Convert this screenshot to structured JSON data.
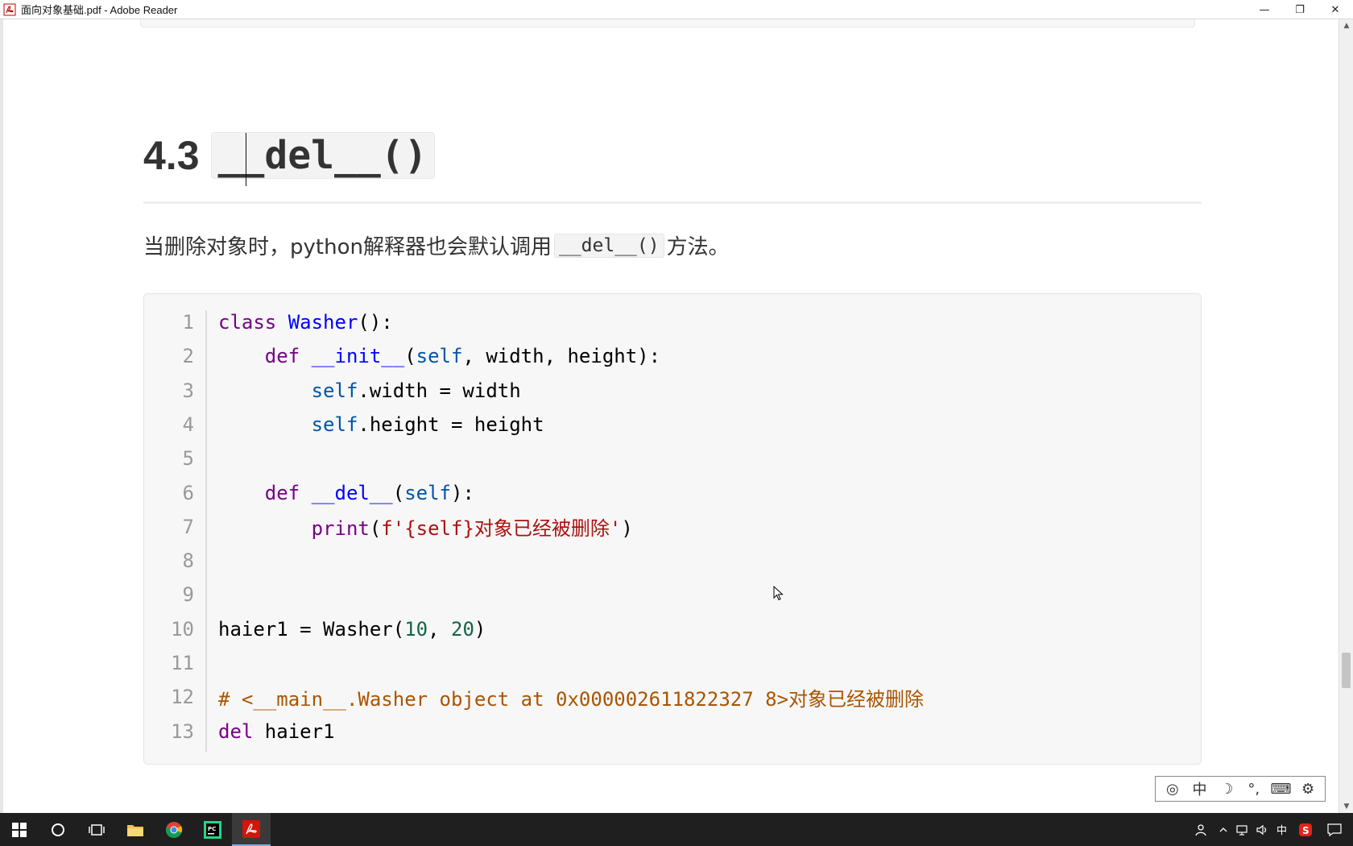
{
  "window": {
    "title": "面向对象基础.pdf - Adobe Reader",
    "minimize_label": "—",
    "restore_label": "❐",
    "close_label": "✕"
  },
  "document": {
    "section_number": "4.3",
    "section_code": "__del__()",
    "paragraph_before": "当删除对象时，python解释器也会默认调用",
    "paragraph_code": "__del__()",
    "paragraph_after": "方法。",
    "code_lines": [
      {
        "n": "1",
        "tokens": [
          [
            "kw",
            "class "
          ],
          [
            "def",
            "Washer"
          ],
          [
            "",
            "():"
          ]
        ]
      },
      {
        "n": "2",
        "tokens": [
          [
            "",
            "    "
          ],
          [
            "kw",
            "def "
          ],
          [
            "def",
            "__init__"
          ],
          [
            "",
            "("
          ],
          [
            "var2",
            "self"
          ],
          [
            "",
            ", width, height):"
          ]
        ]
      },
      {
        "n": "3",
        "tokens": [
          [
            "",
            "        "
          ],
          [
            "var2",
            "self"
          ],
          [
            "",
            ".width = width"
          ]
        ]
      },
      {
        "n": "4",
        "tokens": [
          [
            "",
            "        "
          ],
          [
            "var2",
            "self"
          ],
          [
            "",
            ".height = height"
          ]
        ]
      },
      {
        "n": "5",
        "tokens": [
          [
            "",
            ""
          ]
        ]
      },
      {
        "n": "6",
        "tokens": [
          [
            "",
            "    "
          ],
          [
            "kw",
            "def "
          ],
          [
            "def",
            "__del__"
          ],
          [
            "",
            "("
          ],
          [
            "var2",
            "self"
          ],
          [
            "",
            "):"
          ]
        ]
      },
      {
        "n": "7",
        "tokens": [
          [
            "",
            "        "
          ],
          [
            "kw",
            "print"
          ],
          [
            "",
            "("
          ],
          [
            "str",
            "f'{self}对象已经被删除'"
          ],
          [
            "",
            ")"
          ]
        ]
      },
      {
        "n": "8",
        "tokens": [
          [
            "",
            ""
          ]
        ]
      },
      {
        "n": "9",
        "tokens": [
          [
            "",
            ""
          ]
        ]
      },
      {
        "n": "10",
        "tokens": [
          [
            "",
            "haier1 = Washer("
          ],
          [
            "num2",
            "10"
          ],
          [
            "",
            ", "
          ],
          [
            "num2",
            "20"
          ],
          [
            "",
            ")"
          ]
        ]
      },
      {
        "n": "11",
        "tokens": [
          [
            "",
            ""
          ]
        ]
      },
      {
        "n": "12",
        "tokens": [
          [
            "cmt",
            "# <__main__.Washer object at 0x000002611822327 8>对象已经被删除"
          ]
        ]
      },
      {
        "n": "13",
        "tokens": [
          [
            "kw",
            "del "
          ],
          [
            "",
            "haier1"
          ]
        ]
      }
    ]
  },
  "ime": {
    "items": [
      "◎",
      "中",
      "☽",
      "°,",
      "⌨",
      "⚙"
    ]
  },
  "taskbar": {
    "tray_ime": "中",
    "tray_s": "S"
  },
  "colors": {
    "keyword": "#770088",
    "definition": "#0000ff",
    "self": "#0055aa",
    "string": "#aa1111",
    "number": "#116644",
    "comment": "#aa5500"
  }
}
